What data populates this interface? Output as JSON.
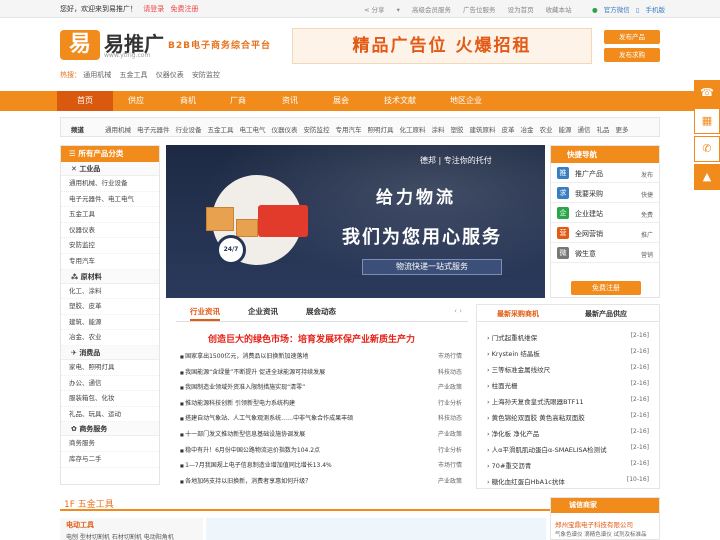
{
  "topbar": {
    "welcome": "您好，欢迎来到易推广！",
    "login": "请登录",
    "register": "免费注册",
    "share": "分享",
    "links": [
      "高级会员服务",
      "广告位服务",
      "设为首页",
      "收藏本站"
    ],
    "wechat": "官方微信",
    "mobile": "手机版"
  },
  "header": {
    "logo_char": "易",
    "logo_text": "易推广",
    "logo_url": "www.ytlrig.com",
    "slogan": "B2B电子商务综合平台",
    "ad_text": "精品广告位 火爆招租",
    "btn_product": "发布产品",
    "btn_buy": "发布求购",
    "hot_label": "热搜：",
    "hot_items": [
      "通用机械",
      "五金工具",
      "仪器仪表",
      "安防监控"
    ]
  },
  "nav": {
    "items": [
      "首页",
      "供应",
      "商机",
      "厂商",
      "资讯",
      "展会",
      "技术文献",
      "地区企业"
    ]
  },
  "channels": {
    "label": "频道",
    "items": [
      "通用机械",
      "电子元器件",
      "行业设备",
      "五金工具",
      "电工电气",
      "仪器仪表",
      "安防监控",
      "专用汽车",
      "照明灯具",
      "化工原料",
      "涂料",
      "塑胶",
      "建筑原料",
      "皮革",
      "冶金",
      "农业",
      "能源",
      "通信",
      "礼品",
      "更多"
    ]
  },
  "categories": {
    "title": "所有产品分类",
    "sections": [
      {
        "name": "工业品",
        "rows": [
          "通用机械、行业设备",
          "电子元器件、电工电气",
          "五金工具",
          "仪器仪表",
          "安防监控",
          "专用汽车"
        ]
      },
      {
        "name": "原材料",
        "rows": [
          "化工、涂料",
          "塑胶、皮革",
          "建筑、能源",
          "冶金、农业"
        ]
      },
      {
        "name": "消费品",
        "rows": [
          "家电、照明灯具",
          "办公、通信",
          "服装箱包、化妆",
          "礼品、玩具、运动"
        ]
      },
      {
        "name": "商务服务",
        "rows": [
          "商务服务",
          "库存与二手"
        ]
      }
    ]
  },
  "banner": {
    "brand": "德邦 | 专注你的托付",
    "title": "给力物流",
    "subtitle": "我们为您用心服务",
    "tagline": "物流快递一站式服务",
    "clock_text": "24/7"
  },
  "quicknav": {
    "title": "快捷导航",
    "rows": [
      {
        "icon": "推",
        "name": "推广产品",
        "action": "发布",
        "color": "#3a7ec2"
      },
      {
        "icon": "求",
        "name": "我要采购",
        "action": "快捷",
        "color": "#3a7ec2"
      },
      {
        "icon": "企",
        "name": "企业建站",
        "action": "免费",
        "color": "#2aa64a"
      },
      {
        "icon": "营",
        "name": "全网营销",
        "action": "推广",
        "color": "#e25a15"
      },
      {
        "icon": "微",
        "name": "微生意",
        "action": "营销",
        "color": "#777777"
      }
    ],
    "register": "免费注册"
  },
  "news": {
    "tabs": [
      "行业资讯",
      "企业资讯",
      "展会动态"
    ],
    "arrows": "‹ ›",
    "headline": "创造巨大的绿色市场：培育发展环保产业新质生产力",
    "items": [
      {
        "title": "国家拿出1500亿元，消费品以旧换新加速落地",
        "cat": "市场行情"
      },
      {
        "title": "我国能源“含绿量”不断提升 促进全球能源可持续发展",
        "cat": "科技动态"
      },
      {
        "title": "我国制造业领域外资准入限制措施实现“清零”",
        "cat": "产业政策"
      },
      {
        "title": "推动能源科技创新 引领新型电力系统构建",
        "cat": "行业分析"
      },
      {
        "title": "搭建自动气象站、人工气象观测系统……中非气象合作成果丰硕",
        "cat": "科技动态"
      },
      {
        "title": "十一部门发文推动新型信息基础设施协调发展",
        "cat": "产业政策"
      },
      {
        "title": "稳中有升！6月份中国公路物流运价指数为104.2点",
        "cat": "行业分析"
      },
      {
        "title": "1—7月我国规上电子信息制造业增加值同比增长13.4%",
        "cat": "市场行情"
      },
      {
        "title": "各地加码支持以旧换新，消费者享惠如何升级？",
        "cat": "产业政策"
      }
    ]
  },
  "supply": {
    "tabs": [
      "最新采购商机",
      "最新产品供应"
    ],
    "items": [
      {
        "title": "门式起重机维保",
        "date": "[2-16]"
      },
      {
        "title": "Krystein 结晶板",
        "date": "[2-16]"
      },
      {
        "title": "三等标准金属线纹尺",
        "date": "[2-16]"
      },
      {
        "title": "柱面光栅",
        "date": "[2-16]"
      },
      {
        "title": "上海孙天复食皇式洗眼器BTF11",
        "date": "[2-16]"
      },
      {
        "title": "黄色锦纶双面胶 黄色高粘双面胶",
        "date": "[2-16]"
      },
      {
        "title": "净化板 净化产品",
        "date": "[2-16]"
      },
      {
        "title": "人α平滑肌肌动蛋白α-SMAELISA检测试",
        "date": "[2-16]"
      },
      {
        "title": "70#重交沥青",
        "date": "[2-16]"
      },
      {
        "title": "糖化血红蛋白HbA1c抗体",
        "date": "[10-16]"
      }
    ]
  },
  "floor": {
    "title": "1F 五金工具",
    "sub": "电动工具",
    "links": "电刨  型材切割机  石材切割机  电动阳角机"
  },
  "business": {
    "title": "诚信商家",
    "name": "郑州宝鼎电子科技有限公司",
    "desc": "气象色谱仪 滴精色谱仪 试剂及标准品"
  },
  "sidebar_icons": [
    "phone-icon",
    "wechat-icon",
    "mobile-icon",
    "top-icon"
  ]
}
